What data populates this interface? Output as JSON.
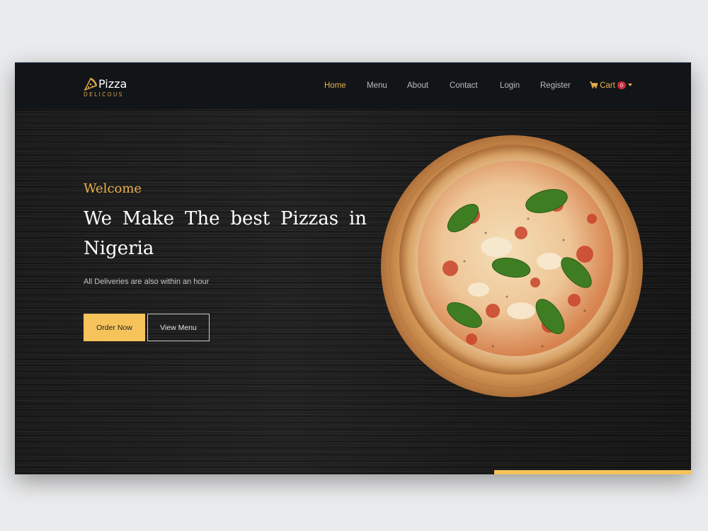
{
  "brand": {
    "name": "Pizza",
    "tagline": "DELICOUS",
    "icon": "pizza-slice-icon"
  },
  "nav": {
    "items": [
      {
        "label": "Home",
        "active": true
      },
      {
        "label": "Menu",
        "active": false
      },
      {
        "label": "About",
        "active": false
      },
      {
        "label": "Contact",
        "active": false
      },
      {
        "label": "Login",
        "active": false
      },
      {
        "label": "Register",
        "active": false
      }
    ],
    "cart": {
      "label": "Cart",
      "count": "0",
      "icon": "cart-icon"
    }
  },
  "hero": {
    "welcome": "Welcome",
    "headline": "We Make The best Pizzas in Nigeria",
    "subtext": "All Deliveries are also within an hour",
    "order_button": "Order Now",
    "menu_button": "View Menu"
  },
  "colors": {
    "accent": "#f5c35a",
    "accent_text": "#e9b04c",
    "navbar": "#121518",
    "badge": "#c72b3b"
  }
}
